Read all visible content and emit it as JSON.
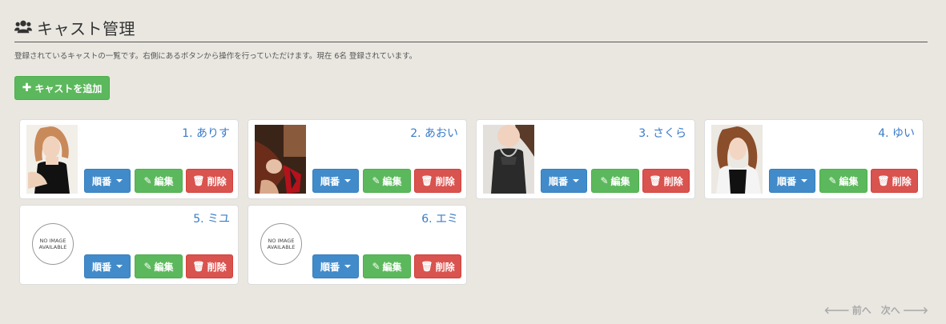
{
  "header": {
    "title": "キャスト管理",
    "icon": "users-icon",
    "subtitle": "登録されているキャストの一覧です。右側にあるボタンから操作を行っていただけます。現在 6名 登録されています。"
  },
  "toolbar": {
    "add_label": "キャストを追加",
    "add_icon": "plus-icon"
  },
  "cards": [
    {
      "name": "1. ありす",
      "has_image": true,
      "order_label": "順番",
      "edit_label": "編集",
      "delete_label": "削除"
    },
    {
      "name": "2. あおい",
      "has_image": true,
      "order_label": "順番",
      "edit_label": "編集",
      "delete_label": "削除"
    },
    {
      "name": "3. さくら",
      "has_image": true,
      "order_label": "順番",
      "edit_label": "編集",
      "delete_label": "削除"
    },
    {
      "name": "4. ゆい",
      "has_image": true,
      "order_label": "順番",
      "edit_label": "編集",
      "delete_label": "削除"
    },
    {
      "name": "5. ミユ",
      "has_image": false,
      "no_image_line1": "NO IMAGE",
      "no_image_line2": "AVAILABLE",
      "order_label": "順番",
      "edit_label": "編集",
      "delete_label": "削除"
    },
    {
      "name": "6. エミ",
      "has_image": false,
      "no_image_line1": "NO IMAGE",
      "no_image_line2": "AVAILABLE",
      "order_label": "順番",
      "edit_label": "編集",
      "delete_label": "削除"
    }
  ],
  "pager": {
    "prev_label": "前へ",
    "next_label": "次へ"
  },
  "colors": {
    "background": "#e9e7e0",
    "primary": "#428bca",
    "success": "#5cb85c",
    "danger": "#d9534f",
    "name_text": "#3a7bc8"
  }
}
